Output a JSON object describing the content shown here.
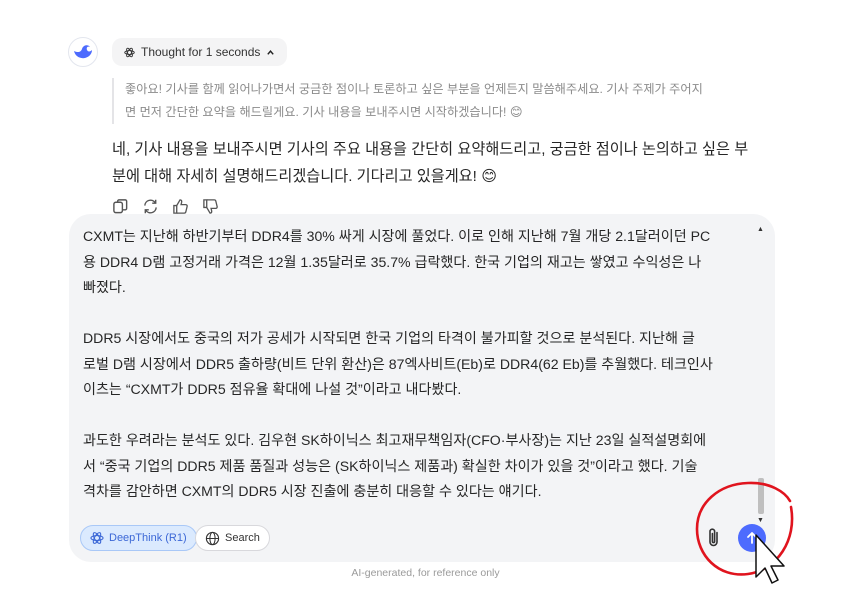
{
  "thought": {
    "label": "Thought for 1 seconds",
    "icon": "atom-icon",
    "toggle_icon": "chevron-up-icon"
  },
  "thinking_lines": [
    "좋아요! 기사를 함께 읽어나가면서 궁금한 점이나 토론하고 싶은 부분을 언제든지 말씀해주세요. 기사 주제가 주어지",
    "면 먼저 간단한 요약을 해드릴게요. 기사 내용을 보내주시면 시작하겠습니다! 😊"
  ],
  "answer_lines": [
    "네, 기사 내용을 보내주시면 기사의 주요 내용을 간단히 요약해드리고, 궁금한 점이나 논의하고 싶은 부",
    "분에 대해 자세히 설명해드리겠습니다. 기다리고 있을게요! 😊"
  ],
  "actions": [
    "copy-icon",
    "regenerate-icon",
    "thumbs-up-icon",
    "thumbs-down-icon"
  ],
  "composer": {
    "lines": [
      "CXMT는 지난해 하반기부터 DDR4를 30% 싸게 시장에 풀었다. 이로 인해 지난해 7월 개당 2.1달러이던 PC",
      "용 DDR4 D램 고정거래 가격은 12월 1.35달러로 35.7% 급락했다. 한국 기업의 재고는 쌓였고 수익성은 나",
      "빠졌다.",
      "",
      "DDR5 시장에서도 중국의 저가 공세가 시작되면 한국 기업의 타격이 불가피할 것으로 분석된다. 지난해 글",
      "로벌 D램 시장에서 DDR5 출하량(비트 단위 환산)은 87엑사비트(Eb)로 DDR4(62 Eb)를 추월했다. 테크인사",
      "이츠는 “CXMT가 DDR5 점유율 확대에 나설 것”이라고 내다봤다.",
      "",
      "과도한 우려라는 분석도 있다. 김우현 SK하이닉스 최고재무책임자(CFO·부사장)는 지난 23일 실적설명회에",
      "서 “중국 기업의 DDR5 제품 품질과 성능은 (SK하이닉스 제품과) 확실한 차이가 있을 것”이라고 했다. 기술",
      "격차를 감안하면 CXMT의 DDR5 시장 진출에 충분히 대응할 수 있다는 얘기다."
    ],
    "deepthink_label": "DeepThink (R1)",
    "search_label": "Search"
  },
  "footer": "AI-generated, for reference only",
  "colors": {
    "accent": "#4d6bfe",
    "annotation": "#e0141e"
  }
}
